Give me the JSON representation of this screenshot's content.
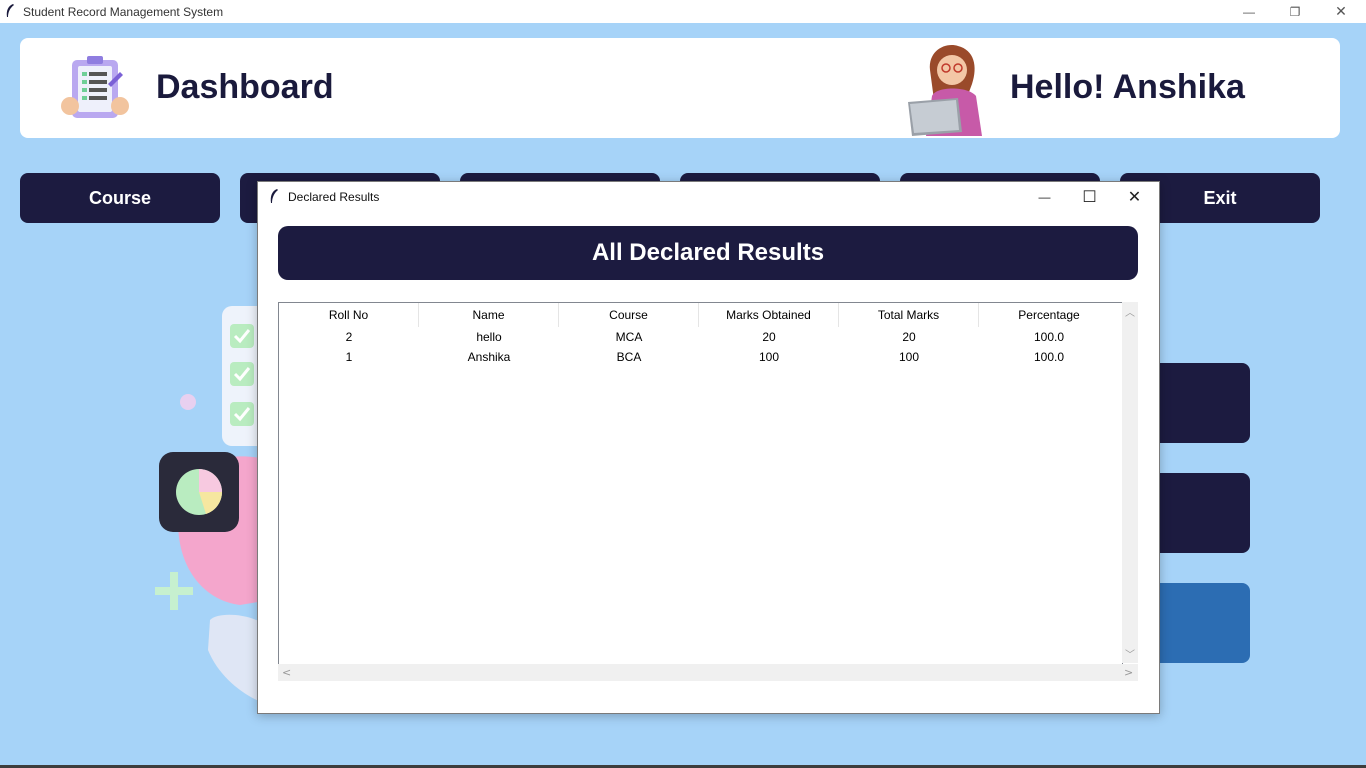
{
  "window": {
    "title": "Student Record Management System",
    "controls": {
      "minimize": "—",
      "restore": "❐",
      "close": "✕"
    }
  },
  "header": {
    "title": "Dashboard",
    "greeting": "Hello! Anshika"
  },
  "nav": {
    "buttons": [
      "Course",
      "",
      "",
      "",
      "",
      "Exit"
    ]
  },
  "dialog": {
    "title": "Declared Results",
    "heading": "All Declared Results",
    "controls": {
      "minimize": "—",
      "maximize": "☐",
      "close": "✕"
    },
    "table": {
      "columns": [
        "Roll No",
        "Name",
        "Course",
        "Marks Obtained",
        "Total Marks",
        "Percentage"
      ],
      "rows": [
        [
          "2",
          "hello",
          "MCA",
          "20",
          "20",
          "100.0"
        ],
        [
          "1",
          "Anshika",
          "BCA",
          "100",
          "100",
          "100.0"
        ]
      ]
    },
    "scrollbar": {
      "up": "︿",
      "down": "﹀",
      "left": "<",
      "right": ">"
    }
  },
  "colors": {
    "background": "#a6d3f8",
    "navy": "#1c1b40",
    "accent_blue": "#2c6db3",
    "white": "#ffffff"
  }
}
